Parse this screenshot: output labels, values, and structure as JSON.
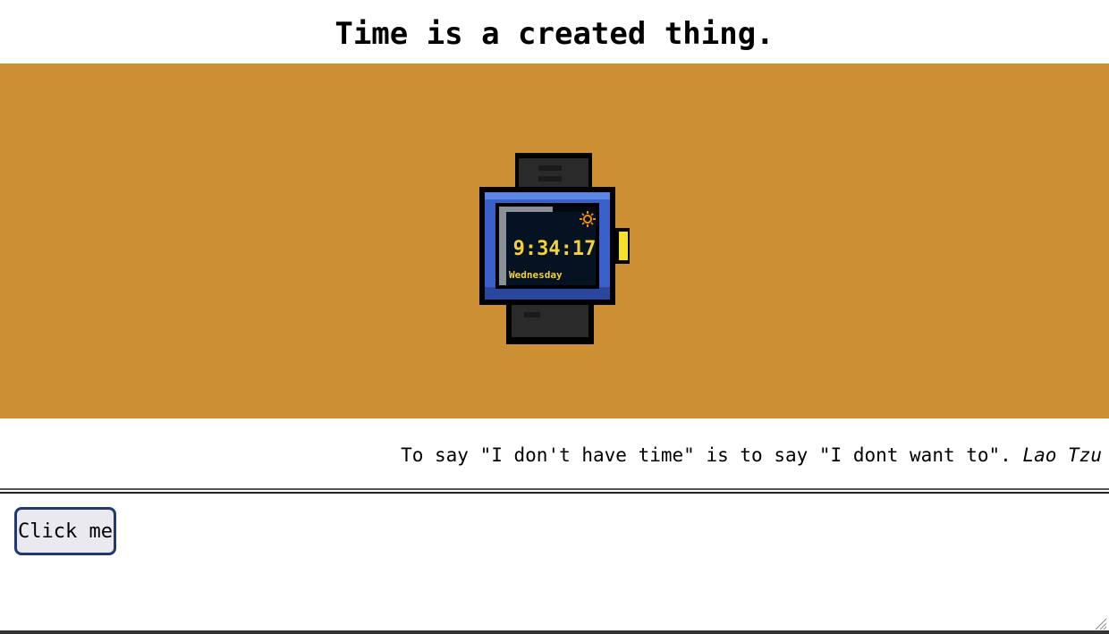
{
  "header": {
    "title": "Time is a created thing."
  },
  "banner": {
    "background_color": "#cc8f33"
  },
  "watch": {
    "time": "9:34:17",
    "day": "Wednesday",
    "icon": "sun-icon",
    "band_color": "#2a2a2a",
    "case_color": "#3a5fc8",
    "screen_color": "#020812",
    "text_color": "#f2d13a",
    "crown_color": "#f2e02a"
  },
  "quote": {
    "text": "To say \"I don't have time\" is to say \"I dont want to\".",
    "author": "Lao Tzu"
  },
  "controls": {
    "button_label": "Click me",
    "button_border_color": "#203a6e"
  }
}
